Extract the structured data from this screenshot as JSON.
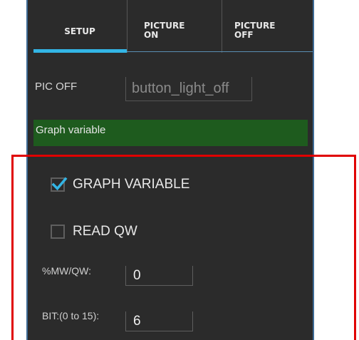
{
  "tabs": [
    {
      "line1": "SETUP",
      "line2": ""
    },
    {
      "line1": "PICTURE",
      "line2": "ON"
    },
    {
      "line1": "PICTURE",
      "line2": "OFF"
    }
  ],
  "pic_off": {
    "label": "PIC OFF",
    "value": "button_light_off"
  },
  "section_header": "Graph variable",
  "checkboxes": [
    {
      "label": "GRAPH VARIABLE",
      "checked": true
    },
    {
      "label": "READ QW",
      "checked": false
    }
  ],
  "mw_qw": {
    "label": "%MW/QW:",
    "value": "0"
  },
  "bit": {
    "label": "BIT:(0 to 15):",
    "value": "6"
  },
  "colors": {
    "panel_bg": "#2b2b2b",
    "tab_accent": "#33b5e5",
    "section_header_bg": "#1e5b1e",
    "highlight_frame": "#e00000"
  }
}
